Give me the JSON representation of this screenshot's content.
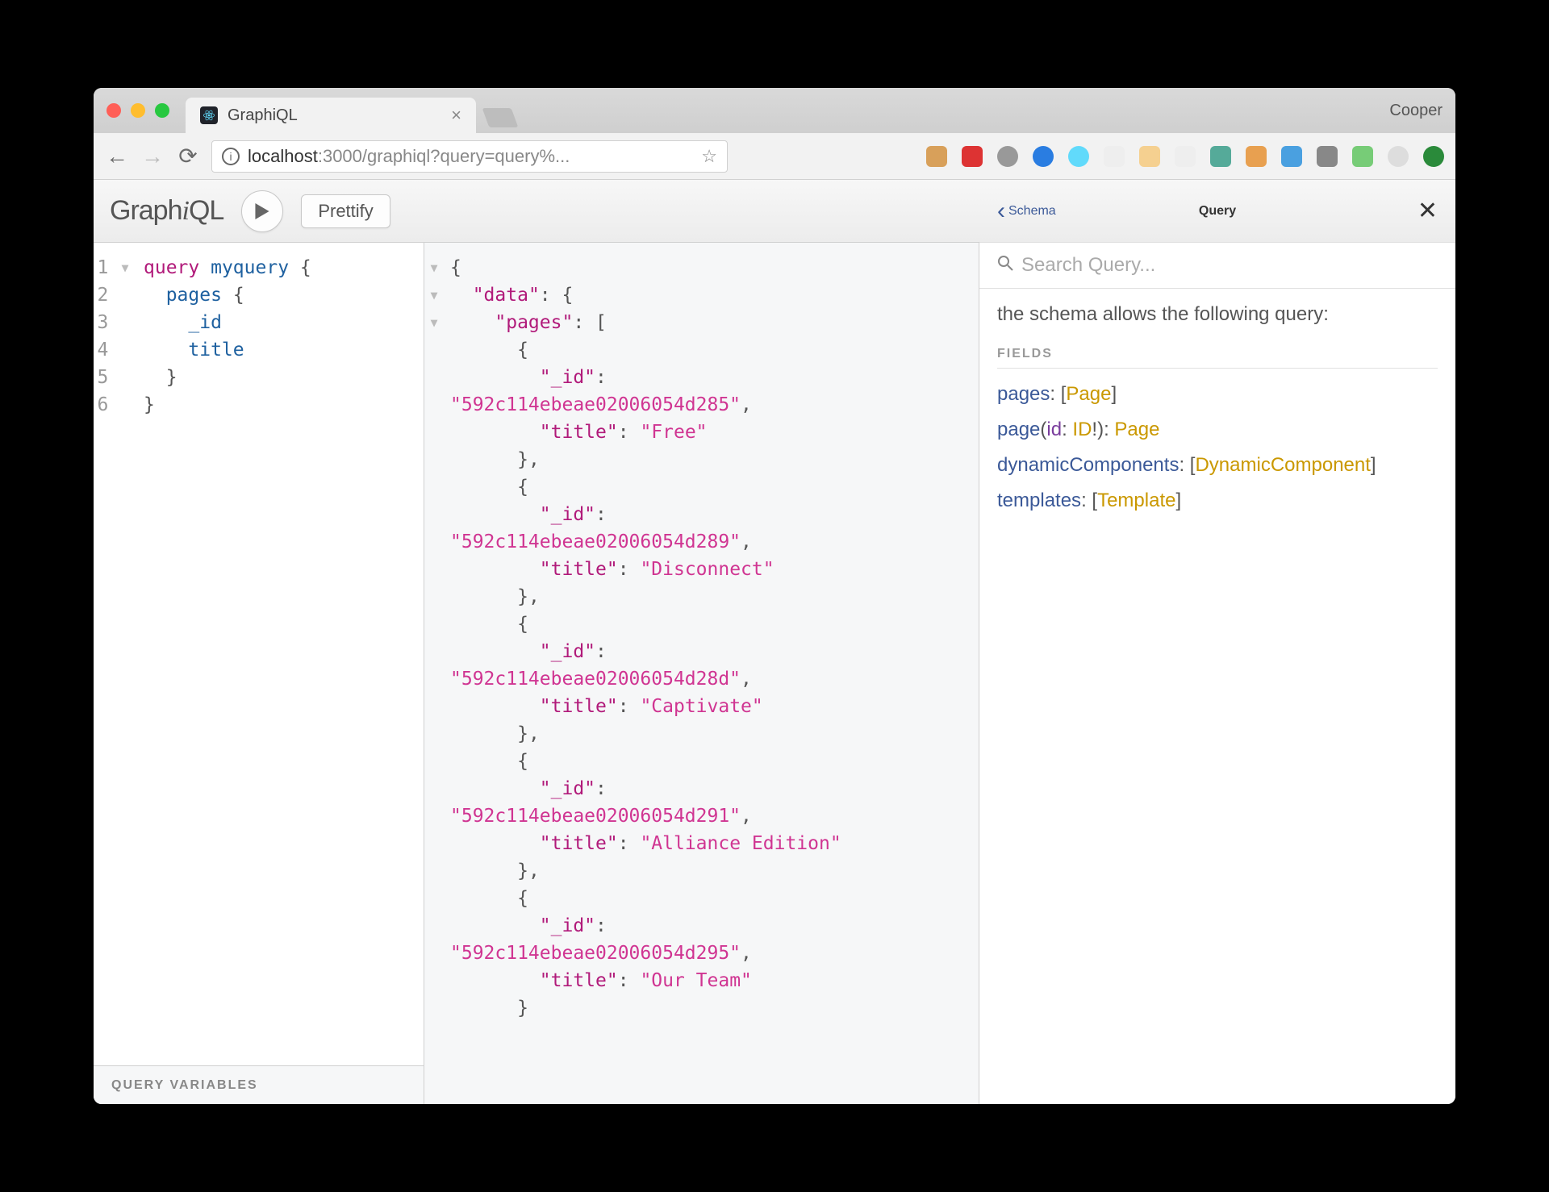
{
  "browser": {
    "tab_title": "GraphiQL",
    "profile_name": "Cooper",
    "url_host": "localhost",
    "url_port": ":3000",
    "url_path": "/graphiql?query=query%..."
  },
  "toolbar": {
    "logo_prefix": "Graph",
    "logo_i": "i",
    "logo_suffix": "QL",
    "prettify_label": "Prettify"
  },
  "editor": {
    "lines": [
      {
        "n": 1,
        "content_html": "<span class='kw'>query</span> <span class='def'>myquery</span> <span class='punc'>{</span>",
        "fold": true
      },
      {
        "n": 2,
        "content_html": "  <span class='attr'>pages</span> <span class='punc'>{</span>",
        "fold": false
      },
      {
        "n": 3,
        "content_html": "    <span class='prop'>_id</span>",
        "fold": false
      },
      {
        "n": 4,
        "content_html": "    <span class='prop'>title</span>",
        "fold": false
      },
      {
        "n": 5,
        "content_html": "  <span class='punc'>}</span>",
        "fold": false
      },
      {
        "n": 6,
        "content_html": "<span class='punc'>}</span>",
        "fold": false
      }
    ],
    "query_variables_label": "QUERY VARIABLES"
  },
  "result": {
    "data": {
      "pages": [
        {
          "_id": "592c114ebeae02006054d285",
          "title": "Free"
        },
        {
          "_id": "592c114ebeae02006054d289",
          "title": "Disconnect"
        },
        {
          "_id": "592c114ebeae02006054d28d",
          "title": "Captivate"
        },
        {
          "_id": "592c114ebeae02006054d291",
          "title": "Alliance Edition"
        },
        {
          "_id": "592c114ebeae02006054d295",
          "title": "Our Team"
        }
      ]
    }
  },
  "docs": {
    "back_label": "Schema",
    "title": "Query",
    "search_placeholder": "Search Query...",
    "description": "the schema allows the following query:",
    "fields_label": "FIELDS",
    "fields": [
      {
        "name": "pages",
        "args_html": "",
        "type_html": "[<span class='type-name'>Page</span>]"
      },
      {
        "name": "page",
        "args_html": "(<span class='argname'>id</span>: <span class='type-name'>ID</span>!)",
        "type_html": "<span class='type-name'>Page</span>"
      },
      {
        "name": "dynamicComponents",
        "args_html": "",
        "type_html": "[<span class='type-name'>DynamicComponent</span>]"
      },
      {
        "name": "templates",
        "args_html": "",
        "type_html": "[<span class='type-name'>Template</span>]"
      }
    ]
  }
}
